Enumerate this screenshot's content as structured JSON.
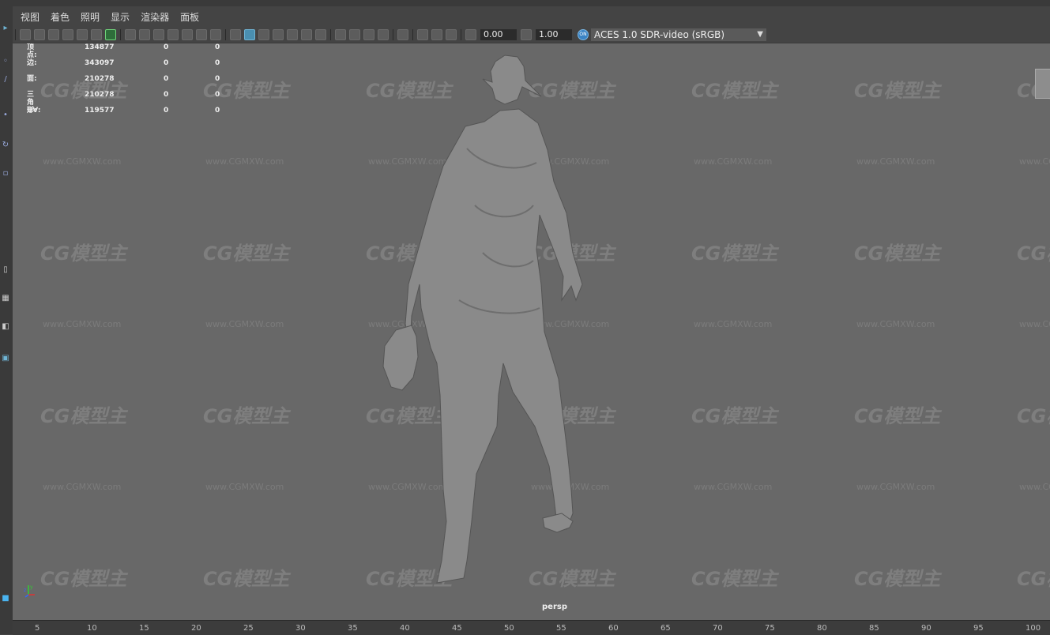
{
  "menu": [
    "视图",
    "着色",
    "照明",
    "显示",
    "渲染器",
    "面板"
  ],
  "toolbar": {
    "exposure": "0.00",
    "gamma": "1.00",
    "color_space": "ACES 1.0 SDR-video (sRGB)",
    "ocio_badge": "ON"
  },
  "hud": [
    {
      "label": "顶点:",
      "v1": "134877",
      "v2": "0",
      "v3": "0"
    },
    {
      "label": "边:",
      "v1": "343097",
      "v2": "0",
      "v3": "0"
    },
    {
      "label": "面:",
      "v1": "210278",
      "v2": "0",
      "v3": "0"
    },
    {
      "label": "三角形:",
      "v1": "210278",
      "v2": "0",
      "v3": "0"
    },
    {
      "label": "UV:",
      "v1": "119577",
      "v2": "0",
      "v3": "0"
    }
  ],
  "viewport": {
    "camera": "persp",
    "axis_labels": {
      "y": "y",
      "z": "z"
    }
  },
  "watermark": {
    "logo": "CG模型主",
    "url": "www.CGMXW.com"
  },
  "ruler_ticks": [
    "5",
    "10",
    "15",
    "20",
    "25",
    "30",
    "35",
    "40",
    "45",
    "50",
    "55",
    "60",
    "65",
    "70",
    "75",
    "80",
    "85",
    "90",
    "95",
    "100"
  ],
  "colors": {
    "viewport_bg": "#686868",
    "ui_bg": "#444444",
    "accent": "#4a8fb0"
  }
}
